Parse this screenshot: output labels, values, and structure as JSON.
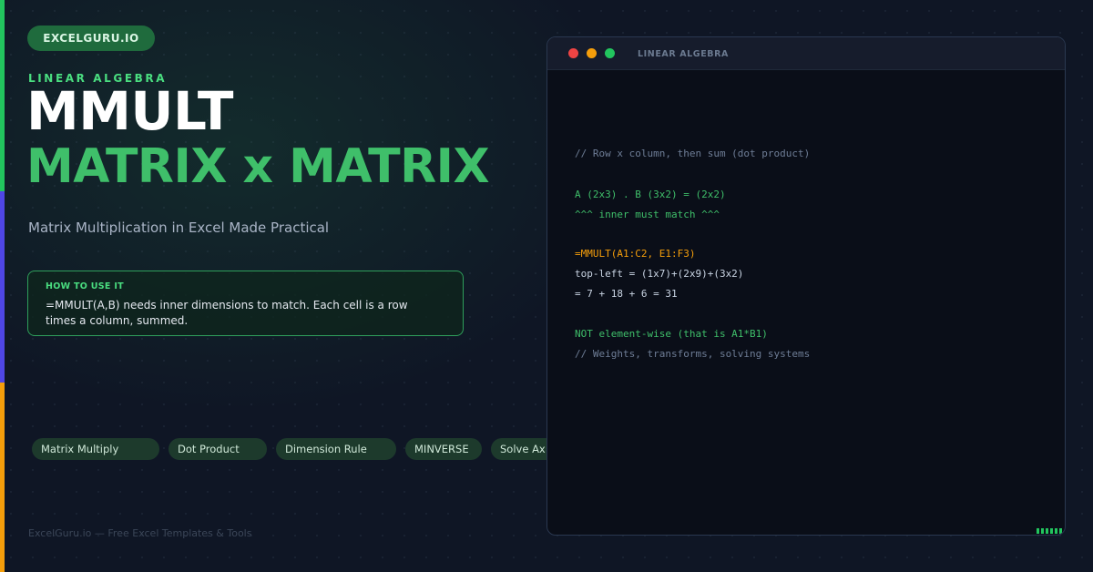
{
  "brand": {
    "label": "EXCELGURU.IO"
  },
  "hero": {
    "eyebrow": "LINEAR ALGEBRA",
    "title_line1": "MMULT",
    "title_line2": "MATRIX x MATRIX",
    "subtitle": "Matrix Multiplication in Excel Made Practical"
  },
  "tip": {
    "heading": "HOW TO USE IT",
    "text": "=MMULT(A,B) needs inner dimensions to match. Each cell is a row times a column, summed."
  },
  "tags": [
    "Matrix Multiply",
    "Dot Product",
    "Dimension Rule",
    "MINVERSE",
    "Solve Ax=b"
  ],
  "footer": "ExcelGuru.io — Free Excel Templates & Tools",
  "code_window": {
    "title": "LINEAR ALGEBRA",
    "lines": [
      "// Row x column, then sum (dot product)",
      "A (2x3) . B (3x2) = (2x2)",
      "^^^ inner must match ^^^",
      "=MMULT(A1:C2, E1:F3)",
      "top-left = (1x7)+(2x9)+(3x2)",
      "= 7 + 18 + 6 = 31",
      "NOT element-wise (that is A1*B1)",
      "// Weights, transforms, solving systems"
    ]
  },
  "colors": {
    "accent_green": "#22c55e",
    "accent_blue": "#4f46e5",
    "accent_orange": "#f59e0b",
    "title_green": "#3fbf6a",
    "background": "#0f1625"
  }
}
